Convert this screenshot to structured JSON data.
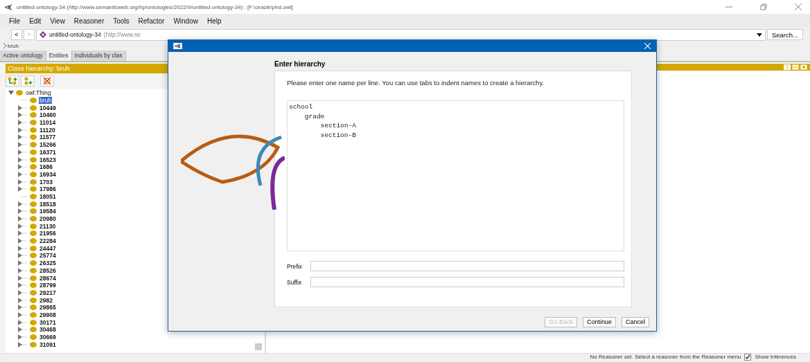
{
  "window": {
    "title": "untitled-ontology-34 (http://www.semanticweb.org/hp/ontologies/2022/9/untitled-ontology-34)  : [F:\\oracle\\phd.owl]"
  },
  "menu": [
    "File",
    "Edit",
    "View",
    "Reasoner",
    "Tools",
    "Refactor",
    "Window",
    "Help"
  ],
  "address_bar": {
    "back_button": "<",
    "forward_button": ">",
    "ontology": "untitled-ontology-34",
    "iri": "(http://www.se",
    "search_button": "Search..."
  },
  "breadcrumb": "bruh",
  "tabs": [
    {
      "label": "Active ontology",
      "selected": false
    },
    {
      "label": "Entities",
      "selected": true
    },
    {
      "label": "Individuals by clas",
      "selected": false
    }
  ],
  "class_hierarchy": {
    "title": "Class hierarchy: bruh",
    "root": {
      "label": "owl:Thing",
      "expanded": true,
      "children": [
        {
          "label": "bruh",
          "selected": true,
          "has_children": false
        },
        {
          "label": "10449",
          "selected": false,
          "has_children": true
        },
        {
          "label": "10460",
          "selected": false,
          "has_children": true
        },
        {
          "label": "11014",
          "selected": false,
          "has_children": true
        },
        {
          "label": "11120",
          "selected": false,
          "has_children": true
        },
        {
          "label": "11577",
          "selected": false,
          "has_children": true
        },
        {
          "label": "15266",
          "selected": false,
          "has_children": true
        },
        {
          "label": "16371",
          "selected": false,
          "has_children": true
        },
        {
          "label": "16523",
          "selected": false,
          "has_children": true
        },
        {
          "label": "1686",
          "selected": false,
          "has_children": true
        },
        {
          "label": "16934",
          "selected": false,
          "has_children": true
        },
        {
          "label": "1703",
          "selected": false,
          "has_children": true
        },
        {
          "label": "17986",
          "selected": false,
          "has_children": true
        },
        {
          "label": "18051",
          "selected": false,
          "has_children": false
        },
        {
          "label": "18518",
          "selected": false,
          "has_children": true
        },
        {
          "label": "19584",
          "selected": false,
          "has_children": true
        },
        {
          "label": "20980",
          "selected": false,
          "has_children": true
        },
        {
          "label": "21130",
          "selected": false,
          "has_children": true
        },
        {
          "label": "21956",
          "selected": false,
          "has_children": true
        },
        {
          "label": "22284",
          "selected": false,
          "has_children": true
        },
        {
          "label": "24447",
          "selected": false,
          "has_children": true
        },
        {
          "label": "25774",
          "selected": false,
          "has_children": true
        },
        {
          "label": "26325",
          "selected": false,
          "has_children": true
        },
        {
          "label": "28526",
          "selected": false,
          "has_children": true
        },
        {
          "label": "28674",
          "selected": false,
          "has_children": true
        },
        {
          "label": "28799",
          "selected": false,
          "has_children": true
        },
        {
          "label": "29217",
          "selected": false,
          "has_children": true
        },
        {
          "label": "2982",
          "selected": false,
          "has_children": true
        },
        {
          "label": "29865",
          "selected": false,
          "has_children": true
        },
        {
          "label": "29908",
          "selected": false,
          "has_children": true
        },
        {
          "label": "30171",
          "selected": false,
          "has_children": true
        },
        {
          "label": "30468",
          "selected": false,
          "has_children": true
        },
        {
          "label": "30669",
          "selected": false,
          "has_children": true
        },
        {
          "label": "31091",
          "selected": false,
          "has_children": true
        }
      ]
    }
  },
  "dialog": {
    "heading": "Enter hierarchy",
    "instructions": "Please enter one name per line. You can use tabs to indent names to create a hierarchy.",
    "hierarchy_text": "school\n\tgrade\n\t\tsection-A\n\t\tsection-B\n",
    "prefix_label": "Prefix",
    "suffix_label": "Suffix",
    "buttons": [
      {
        "label": "Go Back",
        "disabled": true
      },
      {
        "label": "Continue",
        "disabled": false
      },
      {
        "label": "Cancel",
        "disabled": false
      }
    ]
  },
  "status_bar": {
    "message": "No Reasoner set. Select a reasoner from the Reasoner menu",
    "show_inferences": {
      "label": "Show Inferences",
      "checked": true
    }
  }
}
